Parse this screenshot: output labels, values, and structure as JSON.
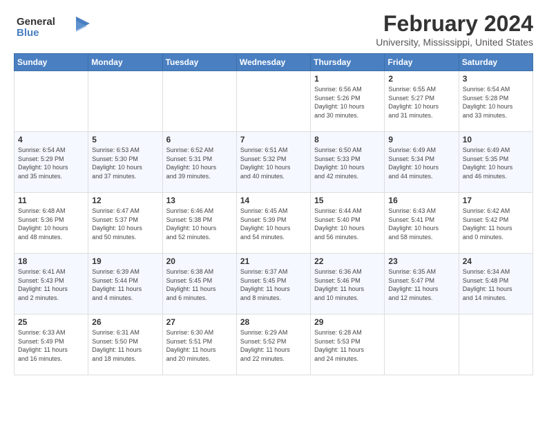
{
  "logo": {
    "line1": "General",
    "line2": "Blue"
  },
  "title": "February 2024",
  "location": "University, Mississippi, United States",
  "header": {
    "days": [
      "Sunday",
      "Monday",
      "Tuesday",
      "Wednesday",
      "Thursday",
      "Friday",
      "Saturday"
    ]
  },
  "weeks": [
    [
      {
        "day": "",
        "info": ""
      },
      {
        "day": "",
        "info": ""
      },
      {
        "day": "",
        "info": ""
      },
      {
        "day": "",
        "info": ""
      },
      {
        "day": "1",
        "info": "Sunrise: 6:56 AM\nSunset: 5:26 PM\nDaylight: 10 hours\nand 30 minutes."
      },
      {
        "day": "2",
        "info": "Sunrise: 6:55 AM\nSunset: 5:27 PM\nDaylight: 10 hours\nand 31 minutes."
      },
      {
        "day": "3",
        "info": "Sunrise: 6:54 AM\nSunset: 5:28 PM\nDaylight: 10 hours\nand 33 minutes."
      }
    ],
    [
      {
        "day": "4",
        "info": "Sunrise: 6:54 AM\nSunset: 5:29 PM\nDaylight: 10 hours\nand 35 minutes."
      },
      {
        "day": "5",
        "info": "Sunrise: 6:53 AM\nSunset: 5:30 PM\nDaylight: 10 hours\nand 37 minutes."
      },
      {
        "day": "6",
        "info": "Sunrise: 6:52 AM\nSunset: 5:31 PM\nDaylight: 10 hours\nand 39 minutes."
      },
      {
        "day": "7",
        "info": "Sunrise: 6:51 AM\nSunset: 5:32 PM\nDaylight: 10 hours\nand 40 minutes."
      },
      {
        "day": "8",
        "info": "Sunrise: 6:50 AM\nSunset: 5:33 PM\nDaylight: 10 hours\nand 42 minutes."
      },
      {
        "day": "9",
        "info": "Sunrise: 6:49 AM\nSunset: 5:34 PM\nDaylight: 10 hours\nand 44 minutes."
      },
      {
        "day": "10",
        "info": "Sunrise: 6:49 AM\nSunset: 5:35 PM\nDaylight: 10 hours\nand 46 minutes."
      }
    ],
    [
      {
        "day": "11",
        "info": "Sunrise: 6:48 AM\nSunset: 5:36 PM\nDaylight: 10 hours\nand 48 minutes."
      },
      {
        "day": "12",
        "info": "Sunrise: 6:47 AM\nSunset: 5:37 PM\nDaylight: 10 hours\nand 50 minutes."
      },
      {
        "day": "13",
        "info": "Sunrise: 6:46 AM\nSunset: 5:38 PM\nDaylight: 10 hours\nand 52 minutes."
      },
      {
        "day": "14",
        "info": "Sunrise: 6:45 AM\nSunset: 5:39 PM\nDaylight: 10 hours\nand 54 minutes."
      },
      {
        "day": "15",
        "info": "Sunrise: 6:44 AM\nSunset: 5:40 PM\nDaylight: 10 hours\nand 56 minutes."
      },
      {
        "day": "16",
        "info": "Sunrise: 6:43 AM\nSunset: 5:41 PM\nDaylight: 10 hours\nand 58 minutes."
      },
      {
        "day": "17",
        "info": "Sunrise: 6:42 AM\nSunset: 5:42 PM\nDaylight: 11 hours\nand 0 minutes."
      }
    ],
    [
      {
        "day": "18",
        "info": "Sunrise: 6:41 AM\nSunset: 5:43 PM\nDaylight: 11 hours\nand 2 minutes."
      },
      {
        "day": "19",
        "info": "Sunrise: 6:39 AM\nSunset: 5:44 PM\nDaylight: 11 hours\nand 4 minutes."
      },
      {
        "day": "20",
        "info": "Sunrise: 6:38 AM\nSunset: 5:45 PM\nDaylight: 11 hours\nand 6 minutes."
      },
      {
        "day": "21",
        "info": "Sunrise: 6:37 AM\nSunset: 5:45 PM\nDaylight: 11 hours\nand 8 minutes."
      },
      {
        "day": "22",
        "info": "Sunrise: 6:36 AM\nSunset: 5:46 PM\nDaylight: 11 hours\nand 10 minutes."
      },
      {
        "day": "23",
        "info": "Sunrise: 6:35 AM\nSunset: 5:47 PM\nDaylight: 11 hours\nand 12 minutes."
      },
      {
        "day": "24",
        "info": "Sunrise: 6:34 AM\nSunset: 5:48 PM\nDaylight: 11 hours\nand 14 minutes."
      }
    ],
    [
      {
        "day": "25",
        "info": "Sunrise: 6:33 AM\nSunset: 5:49 PM\nDaylight: 11 hours\nand 16 minutes."
      },
      {
        "day": "26",
        "info": "Sunrise: 6:31 AM\nSunset: 5:50 PM\nDaylight: 11 hours\nand 18 minutes."
      },
      {
        "day": "27",
        "info": "Sunrise: 6:30 AM\nSunset: 5:51 PM\nDaylight: 11 hours\nand 20 minutes."
      },
      {
        "day": "28",
        "info": "Sunrise: 6:29 AM\nSunset: 5:52 PM\nDaylight: 11 hours\nand 22 minutes."
      },
      {
        "day": "29",
        "info": "Sunrise: 6:28 AM\nSunset: 5:53 PM\nDaylight: 11 hours\nand 24 minutes."
      },
      {
        "day": "",
        "info": ""
      },
      {
        "day": "",
        "info": ""
      }
    ]
  ]
}
